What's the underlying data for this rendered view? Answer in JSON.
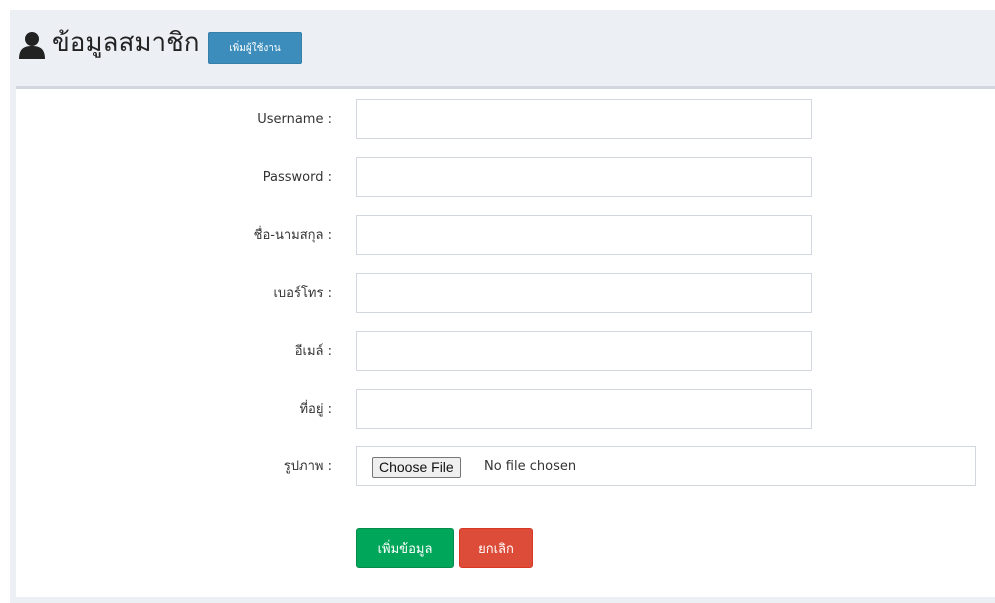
{
  "header": {
    "title": "ข้อมูลสมาชิก",
    "add_user_button": "เพิ่มผู้ใช้งาน",
    "icon": "user-icon"
  },
  "form": {
    "fields": [
      {
        "label": "Username :",
        "value": ""
      },
      {
        "label": "Password :",
        "value": ""
      },
      {
        "label": "ชื่อ-นามสกุล :",
        "value": ""
      },
      {
        "label": "เบอร์โทร :",
        "value": ""
      },
      {
        "label": "อีเมล์ :",
        "value": ""
      },
      {
        "label": "ที่อยู่ :",
        "value": ""
      }
    ],
    "image_label": "รูปภาพ :",
    "choose_file": "Choose File",
    "no_file": "No file chosen",
    "submit_button": "เพิ่มข้อมูล",
    "cancel_button": "ยกเลิก"
  },
  "colors": {
    "primary": "#3c8dbc",
    "success": "#00a65a",
    "danger": "#dd4b39",
    "header_bg": "#ecf0f5"
  }
}
